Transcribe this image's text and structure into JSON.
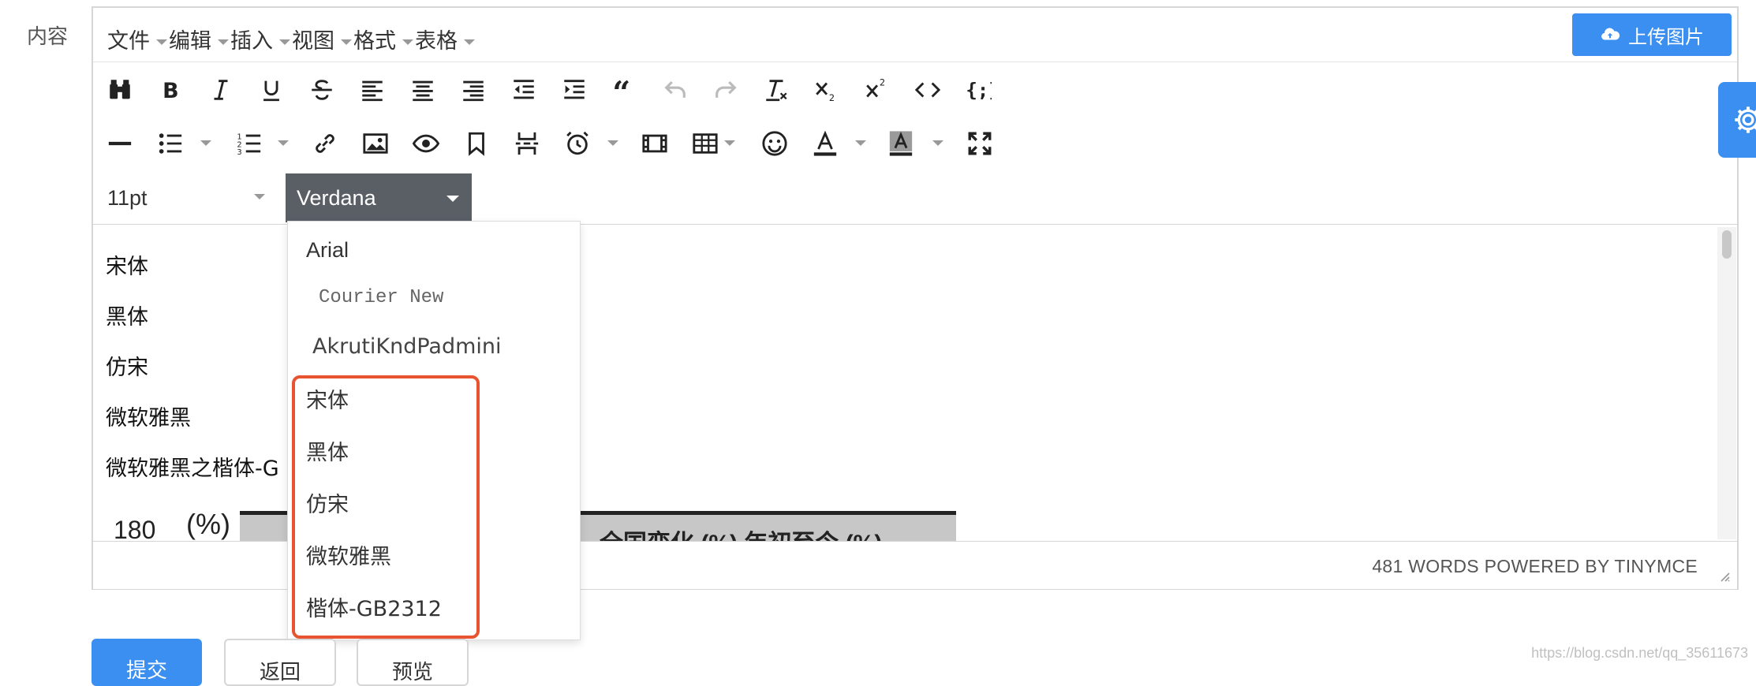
{
  "form": {
    "label": "内容"
  },
  "menubar": {
    "items": [
      "文件",
      "编辑",
      "插入",
      "视图",
      "格式",
      "表格"
    ],
    "upload_button": "上传图片"
  },
  "toolbar": {
    "font_size": "11pt",
    "font_family": "Verdana"
  },
  "content": {
    "lines": [
      "宋体",
      "黑体",
      "仿宋",
      "微软雅黑",
      "微软雅黑之楷体-G"
    ],
    "image_fragment": {
      "left_label": "180",
      "unit_label": "(%)",
      "right_text": "全国变化 (%)   年初至今 (%)"
    }
  },
  "status": {
    "words": "481 WORDS POWERED BY TINYMCE"
  },
  "font_dropdown": {
    "items": [
      "Arial",
      "Courier New",
      "AkrutiKndPadmini",
      "宋体",
      "黑体",
      "仿宋",
      "微软雅黑",
      "楷体-GB2312"
    ],
    "highlighted_count": 5
  },
  "actions": {
    "submit": "提交",
    "back": "返回",
    "preview": "预览"
  },
  "watermark": "https://blog.csdn.net/qq_35611673",
  "colors": {
    "primary": "#3b8ff0",
    "highlight": "#e7542f",
    "select_bg": "#5a5f66"
  }
}
